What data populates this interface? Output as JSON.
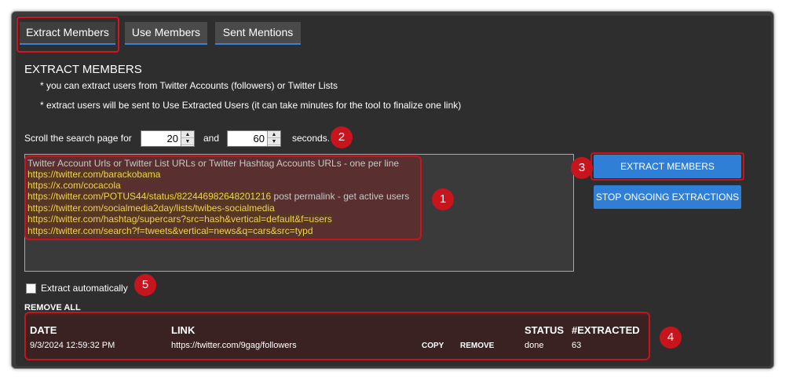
{
  "tabs": [
    {
      "label": "Extract Members"
    },
    {
      "label": "Use Members"
    },
    {
      "label": "Sent Mentions"
    }
  ],
  "section_title": "EXTRACT MEMBERS",
  "notes": [
    "* you can extract users from Twitter Accounts (followers) or Twitter Lists",
    "* extract users will be sent to Use Extracted Users (it can take minutes for the tool to finalize one link)"
  ],
  "scroll": {
    "prefix": "Scroll the search page for",
    "min_value": "20",
    "conjunction": "and",
    "max_value": "60",
    "suffix": "seconds."
  },
  "textarea": {
    "placeholder": "Twitter Account Urls or Twitter List URLs or Twitter Hashtag Accounts URLs - one per line",
    "lines": [
      "https://twitter.com/barackobama",
      "https://x.com/cocacola",
      "https://twitter.com/POTUS44/status/822446982648201216",
      "https://twitter.com/socialmedia2day/lists/twibes-socialmedia",
      "https://twitter.com/hashtag/supercars?src=hash&vertical=default&f=users",
      "https://twitter.com/search?f=tweets&vertical=news&q=cars&src=typd"
    ],
    "line3_note": "post permalink - get active users"
  },
  "buttons": {
    "extract": "EXTRACT MEMBERS",
    "stop": "STOP ONGOING EXTRACTIONS"
  },
  "auto_extract_label": "Extract automatically",
  "remove_all": "REMOVE ALL",
  "table": {
    "headers": [
      "DATE",
      "LINK",
      "STATUS",
      "#EXTRACTED"
    ],
    "rows": [
      {
        "date": "9/3/2024 12:59:32 PM",
        "link": "https://twitter.com/9gag/followers",
        "copy": "COPY",
        "remove": "REMOVE",
        "status": "done",
        "extracted": "63"
      }
    ]
  },
  "badges": [
    "1",
    "2",
    "3",
    "4",
    "5"
  ],
  "colors": {
    "accent_blue": "#2f7fd6",
    "highlight_red": "#c8141d",
    "link_yellow": "#f0d44a",
    "background": "#2e2e2e"
  }
}
